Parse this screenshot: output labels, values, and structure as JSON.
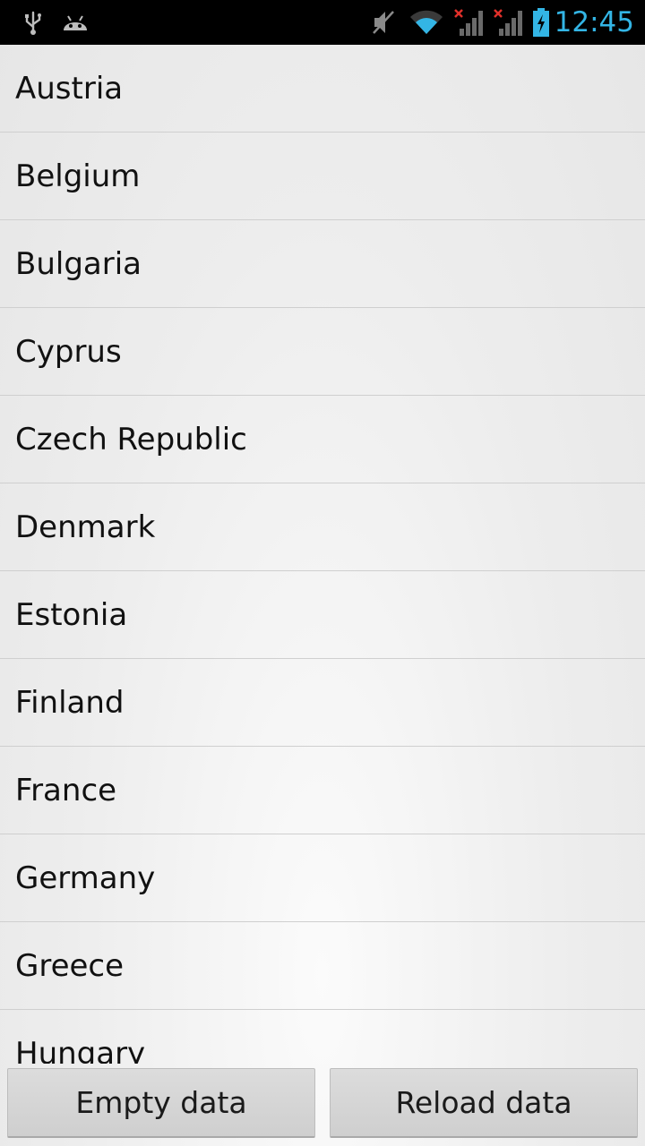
{
  "status_bar": {
    "time": "12:45",
    "icons": [
      "usb-icon",
      "android-debug-icon",
      "mute-icon",
      "wifi-icon",
      "signal-no-service-icon",
      "signal-no-service-icon",
      "battery-charging-icon"
    ],
    "clock_color": "#33b5e5"
  },
  "countries": {
    "items": [
      {
        "label": "Austria"
      },
      {
        "label": "Belgium"
      },
      {
        "label": "Bulgaria"
      },
      {
        "label": "Cyprus"
      },
      {
        "label": "Czech Republic"
      },
      {
        "label": "Denmark"
      },
      {
        "label": "Estonia"
      },
      {
        "label": "Finland"
      },
      {
        "label": "France"
      },
      {
        "label": "Germany"
      },
      {
        "label": "Greece"
      },
      {
        "label": "Hungary"
      }
    ]
  },
  "buttons": {
    "empty_label": "Empty data",
    "reload_label": "Reload data"
  }
}
